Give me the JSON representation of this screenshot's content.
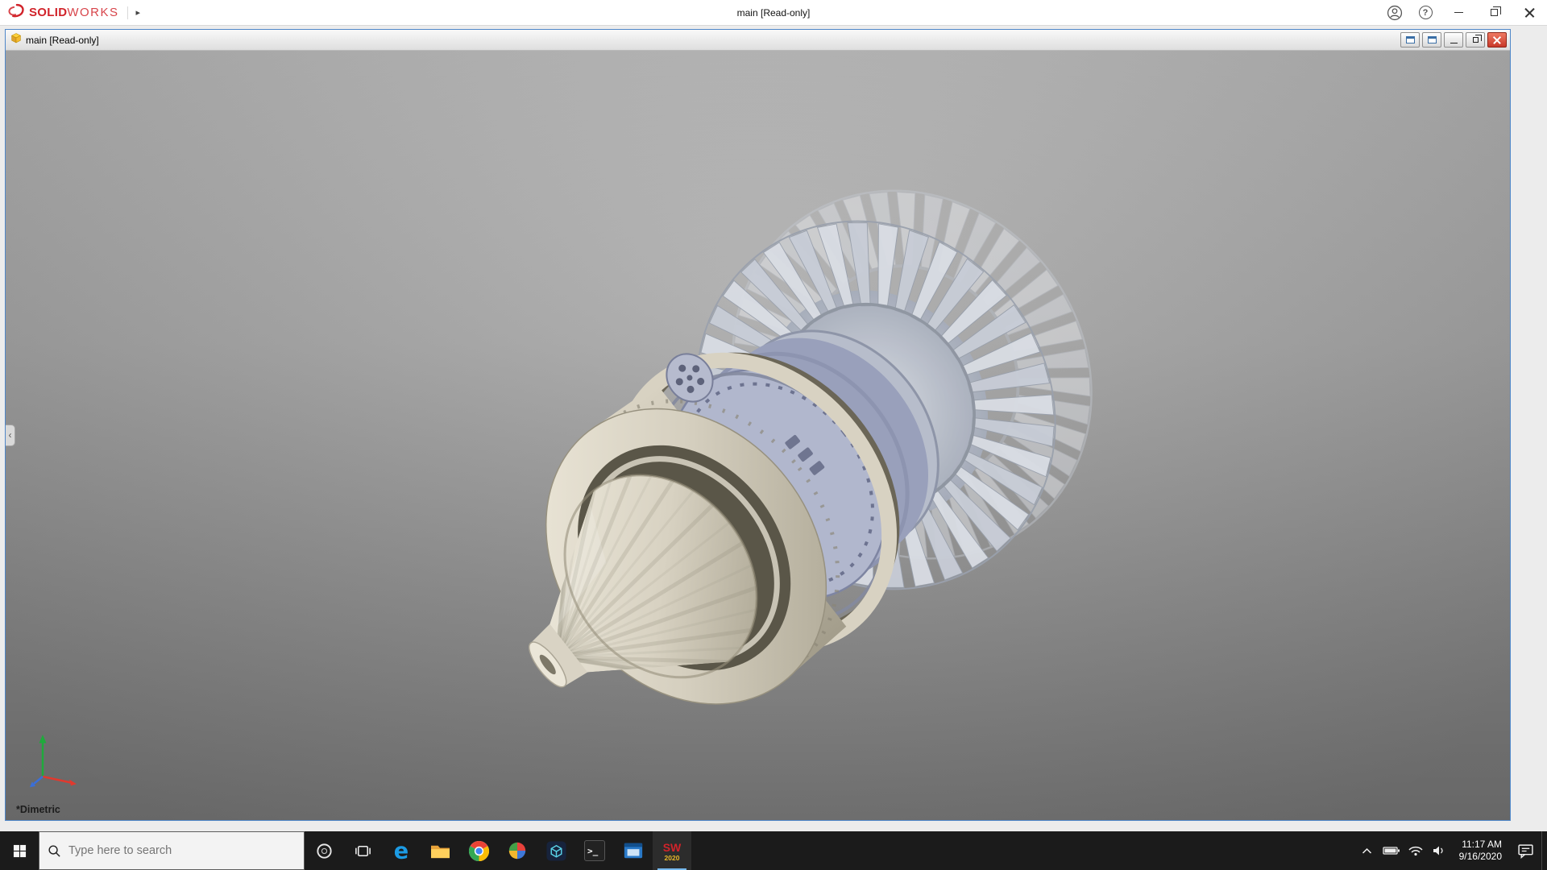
{
  "app": {
    "brand": {
      "solid": "SOLID",
      "works": "WORKS"
    },
    "title": "main [Read-only]"
  },
  "document_window": {
    "title": "main [Read-only]"
  },
  "viewport": {
    "orientation_label": "*Dimetric"
  },
  "taskbar": {
    "search_placeholder": "Type here to search",
    "solidworks": {
      "glyph": "SW",
      "badge": "2020"
    },
    "clock": {
      "time": "11:17 AM",
      "date": "9/16/2020"
    }
  },
  "icons": {
    "menu_arrow": "▸",
    "help_glyph": "?",
    "edge_glyph": "e",
    "cmd_glyph": ">_",
    "panel_collapse_glyph": "‹"
  },
  "colors": {
    "brand_red": "#d1232a",
    "doc_border_blue": "#4f87c9",
    "taskbar_bg": "#1b1b1b",
    "viewport_top": "#b6b6b6",
    "viewport_bottom": "#787878",
    "engine_cream": "#d8d2c2",
    "engine_lavender": "#a7adc6",
    "engine_silver": "#d9dde4"
  }
}
